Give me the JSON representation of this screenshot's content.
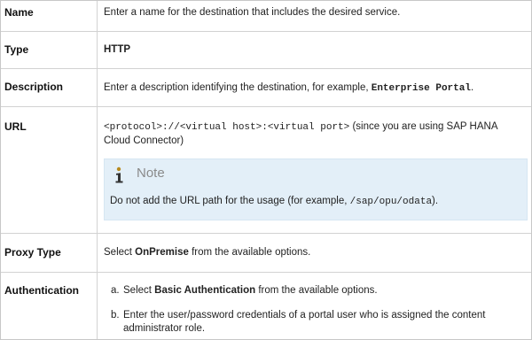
{
  "rows": {
    "name": {
      "label": "Name",
      "value": "Enter a name for the destination that includes the desired service."
    },
    "type": {
      "label": "Type",
      "value": "HTTP"
    },
    "description": {
      "label": "Description",
      "value_prefix": "Enter a description identifying the destination, for example, ",
      "value_code": "Enterprise Portal",
      "value_suffix": "."
    },
    "url": {
      "label": "URL",
      "value_code": "<protocol>://<virtual host>:<virtual port>",
      "value_text": " (since you are using SAP HANA Cloud Connector)",
      "note": {
        "icon": "info-icon",
        "title": "Note",
        "text_prefix": "Do not add the URL path for the usage (for example, ",
        "text_code": "/sap/opu/odata",
        "text_suffix": ")."
      }
    },
    "proxy_type": {
      "label": "Proxy Type",
      "value_prefix": "Select ",
      "value_bold": "OnPremise",
      "value_suffix": " from the available options."
    },
    "authentication": {
      "label": "Authentication",
      "items": [
        {
          "marker": "a.",
          "prefix": "Select ",
          "bold": "Basic Authentication",
          "suffix": " from the available options."
        },
        {
          "marker": "b.",
          "text": "Enter the user/password credentials of a portal user who is assigned the content administrator role."
        }
      ]
    }
  },
  "colors": {
    "note_background": "#e3eff8",
    "border": "#d2d2d2",
    "note_title": "#8a8a8a"
  }
}
